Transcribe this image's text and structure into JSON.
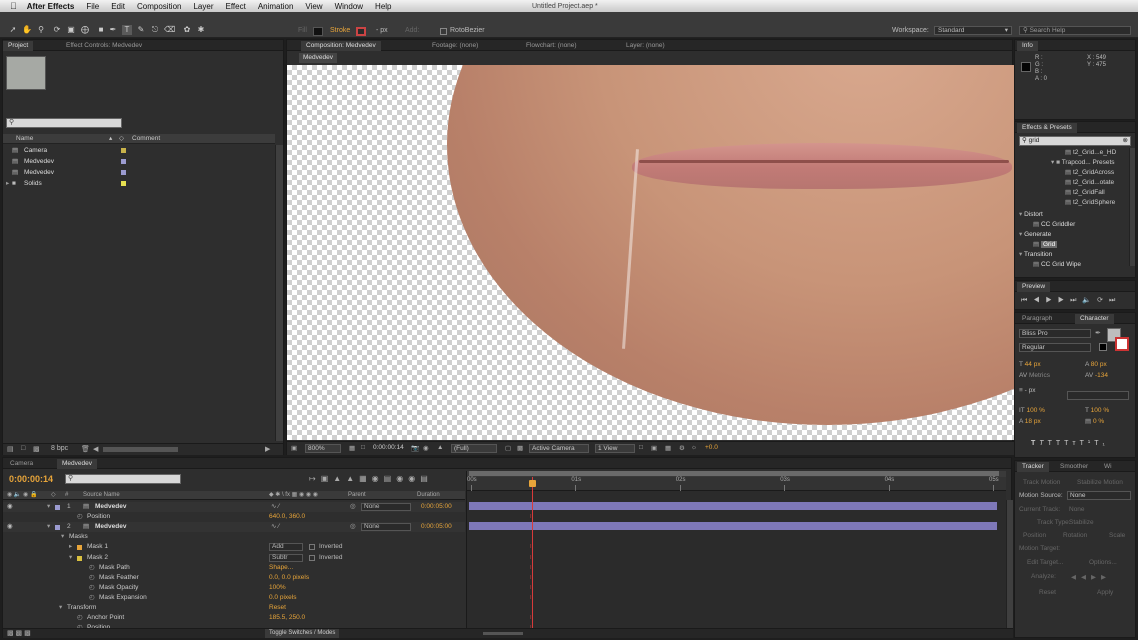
{
  "menubar": {
    "app_name": "After Effects",
    "items": [
      "File",
      "Edit",
      "Composition",
      "Layer",
      "Effect",
      "Animation",
      "View",
      "Window",
      "Help"
    ],
    "document_title": "Untitled Project.aep *"
  },
  "toolbar": {
    "fill_label": "Fill",
    "stroke_label": "Stroke",
    "stroke_width": "- px",
    "add_label": "Add:",
    "rotobezier_label": "RotoBezier",
    "workspace_label": "Workspace:",
    "workspace_value": "Standard",
    "search_placeholder": "Search Help"
  },
  "project_panel": {
    "tabs": [
      "Project",
      "Effect Controls: Medvedev"
    ],
    "search_placeholder": "",
    "columns": {
      "name": "Name",
      "comment": "Comment"
    },
    "items": [
      {
        "name": "Camera",
        "color": "#c8b24a"
      },
      {
        "name": "Medvedev",
        "color": "#9b9bd0"
      },
      {
        "name": "Medvedev",
        "color": "#9b9bd0"
      },
      {
        "name": "Solids",
        "color": "#e6e050"
      }
    ],
    "bpc": "8 bpc"
  },
  "comp_panel": {
    "tabs": [
      "Composition: Medvedev",
      "Footage: (none)",
      "Flowchart: (none)",
      "Layer: (none)"
    ],
    "comp_label": "Medvedev",
    "zoom": "800%",
    "timecode": "0:00:00:14",
    "resolution": "(Full)",
    "camera": "Active Camera",
    "view": "1 View",
    "exposure": "+0.0"
  },
  "info_panel": {
    "tab": "Info",
    "channels": [
      "R :",
      "G :",
      "B :",
      "A : 0"
    ],
    "x": "X : 549",
    "y": "Y : 475"
  },
  "effects_panel": {
    "tab": "Effects & Presets",
    "search_value": "grid",
    "presets": [
      "t2_Grid...e_HD",
      "Trapcod... Presets",
      "t2_GridAcross",
      "t2_Grid...otate",
      "t2_GridFall",
      "t2_GridSphere"
    ],
    "categories": [
      {
        "name": "Distort",
        "items": [
          "CC Griddler"
        ]
      },
      {
        "name": "Generate",
        "items": [
          "Grid"
        ]
      },
      {
        "name": "Transition",
        "items": [
          "CC Grid Wipe"
        ]
      }
    ]
  },
  "preview_panel": {
    "tab": "Preview"
  },
  "character_panel": {
    "tabs": [
      "Paragraph",
      "Character"
    ],
    "font": "Bliss Pro",
    "style": "Regular",
    "size": "44 px",
    "leading": "80 px",
    "kerning": "Metrics",
    "tracking": "-134",
    "stroke_width": "- px",
    "vscale": "100 %",
    "hscale": "100 %",
    "baseline": "18 px",
    "tsume": "0 %",
    "format_buttons": [
      "T",
      "T",
      "TT",
      "Tт",
      "T¹",
      "T₁"
    ]
  },
  "tracker_panel": {
    "tabs": [
      "Tracker",
      "Smoother",
      "Wi"
    ],
    "track_motion": "Track Motion",
    "stabilize_motion": "Stabilize Motion",
    "motion_source_label": "Motion Source:",
    "motion_source_value": "None",
    "current_track_label": "Current Track:",
    "current_track_value": "None",
    "track_type_label": "Track Type:",
    "track_type_value": "Stabilize",
    "position_label": "Position",
    "rotation_label": "Rotation",
    "scale_label": "Scale",
    "motion_target_label": "Motion Target:",
    "edit_target": "Edit Target...",
    "options": "Options...",
    "analyze_label": "Analyze:",
    "reset": "Reset",
    "apply": "Apply"
  },
  "timeline": {
    "tabs": [
      "Camera",
      "Medvedev"
    ],
    "timecode": "0:00:00:14",
    "columns": {
      "source": "Source Name",
      "parent": "Parent",
      "duration": "Duration"
    },
    "ruler": [
      "00s",
      "01s",
      "02s",
      "03s",
      "04s",
      "05s"
    ],
    "playhead_fraction": 0.117,
    "rows": [
      {
        "num": "1",
        "name": "Medvedev",
        "parent": "None",
        "duration": "0:00:05:00",
        "kind": "layer"
      },
      {
        "name": "Position",
        "value": "640.0, 360.0",
        "kind": "prop"
      },
      {
        "num": "2",
        "name": "Medvedev",
        "parent": "None",
        "duration": "0:00:05:00",
        "kind": "layer"
      },
      {
        "name": "Masks",
        "kind": "group"
      },
      {
        "name": "Mask 1",
        "mode": "Add",
        "inverted": "Inverted",
        "kind": "mask",
        "color": "#e8a53a"
      },
      {
        "name": "Mask 2",
        "mode": "Subtr",
        "inverted": "Inverted",
        "kind": "mask",
        "color": "#d9c040"
      },
      {
        "name": "Mask Path",
        "value": "Shape...",
        "kind": "prop"
      },
      {
        "name": "Mask Feather",
        "value": "0.0, 0.0 pixels",
        "kind": "prop"
      },
      {
        "name": "Mask Opacity",
        "value": "100%",
        "kind": "prop"
      },
      {
        "name": "Mask Expansion",
        "value": "0.0 pixels",
        "kind": "prop"
      },
      {
        "name": "Transform",
        "value": "Reset",
        "kind": "group"
      },
      {
        "name": "Anchor Point",
        "value": "185.5, 250.0",
        "kind": "prop"
      },
      {
        "name": "Position",
        "value": "",
        "kind": "prop"
      }
    ],
    "toggle_label": "Toggle Switches / Modes"
  },
  "colors": {
    "accent_orange": "#e8a53a",
    "layer_bar": "#7e78b8",
    "playhead": "#d83a3a"
  }
}
